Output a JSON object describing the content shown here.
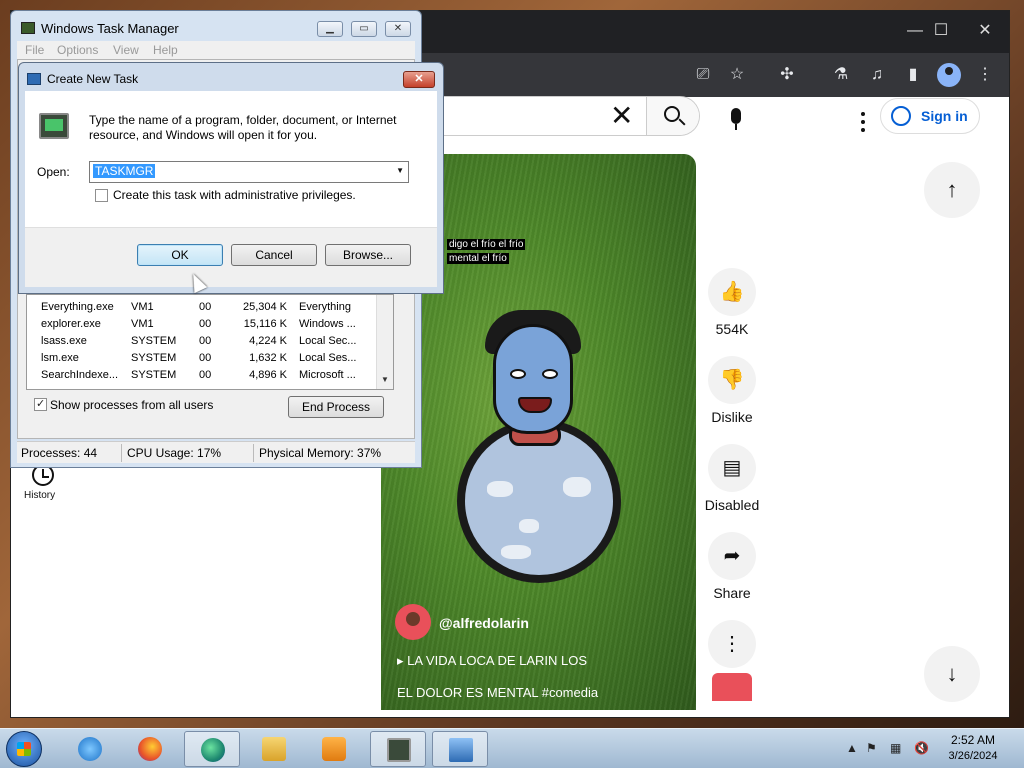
{
  "browser": {
    "search_clear_glyph": "✕",
    "sign_in": "Sign in",
    "sidebar": {
      "history_label": "History"
    },
    "short": {
      "caption_line1": "digo el frío el frío",
      "caption_line2": "mental el frío",
      "channel": "@alfredolarin",
      "title_line1": "LA VIDA LOCA DE LARIN LOS",
      "title_line2": "EL DOLOR ES MENTAL #comedia"
    },
    "actions": {
      "likes": "554K",
      "dislike": "Dislike",
      "comments": "Disabled",
      "share": "Share"
    }
  },
  "task_manager": {
    "title": "Windows Task Manager",
    "menu": [
      "File",
      "Options",
      "View",
      "Help"
    ],
    "processes": [
      {
        "name": "Everything.exe",
        "user": "VM1",
        "cpu": "00",
        "mem": "25,304 K",
        "desc": "Everything"
      },
      {
        "name": "explorer.exe",
        "user": "VM1",
        "cpu": "00",
        "mem": "15,116 K",
        "desc": "Windows ..."
      },
      {
        "name": "lsass.exe",
        "user": "SYSTEM",
        "cpu": "00",
        "mem": "4,224 K",
        "desc": "Local Sec..."
      },
      {
        "name": "lsm.exe",
        "user": "SYSTEM",
        "cpu": "00",
        "mem": "1,632 K",
        "desc": "Local Ses..."
      },
      {
        "name": "SearchIndexe...",
        "user": "SYSTEM",
        "cpu": "00",
        "mem": "4,896 K",
        "desc": "Microsoft ..."
      }
    ],
    "show_all_users": "Show processes from all users",
    "end_process": "End Process",
    "status": {
      "processes": "Processes: 44",
      "cpu": "CPU Usage: 17%",
      "memory": "Physical Memory: 37%"
    }
  },
  "create_task": {
    "title": "Create New Task",
    "description": "Type the name of a program, folder, document, or Internet resource, and Windows will open it for you.",
    "open_label": "Open:",
    "open_value": "TASKMGR",
    "admin_label": "Create this task with administrative privileges.",
    "ok": "OK",
    "cancel": "Cancel",
    "browse": "Browse..."
  },
  "taskbar": {
    "time": "2:52 AM",
    "date": "3/26/2024"
  }
}
